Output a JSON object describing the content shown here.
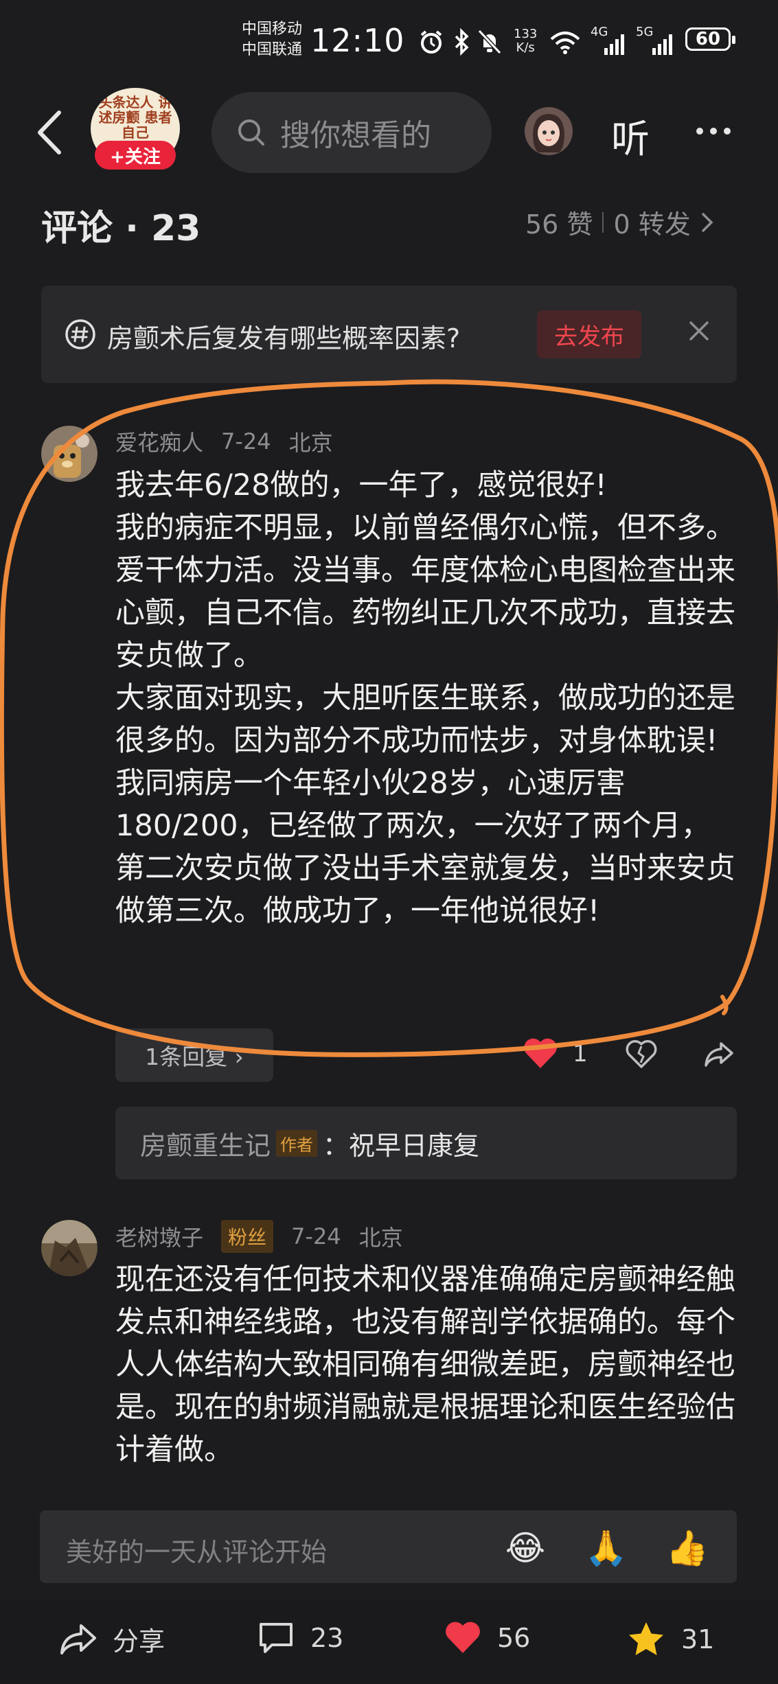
{
  "status_bar": {
    "carrier1": "中国移动",
    "carrier2": "中国联通",
    "time": "12:10",
    "net_speed_value": "133",
    "net_speed_unit": "K/s",
    "signal1_label": "4G",
    "signal2_label": "5G",
    "battery": "60"
  },
  "header": {
    "logo_text": "头条达人 讲述房颤 患者自己",
    "follow_label": "+关注",
    "search_placeholder": "搜你想看的",
    "listen_label": "听"
  },
  "comments_header": {
    "title": "评论 · 23",
    "likes": "56 赞",
    "shares": "0 转发"
  },
  "prompt": {
    "question": "房颤术后复发有哪些概率因素?",
    "publish_label": "去发布"
  },
  "comments": [
    {
      "author": "爱花痴人",
      "date": "7-24",
      "location": "北京",
      "paragraphs": [
        "我去年6/28做的，一年了，感觉很好!",
        "我的病症不明显，以前曾经偶尔心慌，但不多。爱干体力活。没当事。年度体检心电图检查出来心颤，自己不信。药物纠正几次不成功，直接去安贞做了。",
        "大家面对现实，大胆听医生联系，做成功的还是很多的。因为部分不成功而怯步，对身体耽误!",
        "我同病房一个年轻小伙28岁，心速厉害180/200，已经做了两次，一次好了两个月，第二次安贞做了没出手术室就复发，当时来安贞做第三次。做成功了，一年他说很好!"
      ],
      "replies_label": "1条回复 ›",
      "like_count": "1",
      "author_reply": {
        "name": "房颤重生记",
        "badge": "作者",
        "text": "：祝早日康复"
      }
    },
    {
      "author": "老树墩子",
      "badge": "粉丝",
      "date": "7-24",
      "location": "北京",
      "paragraphs": [
        "现在还没有任何技术和仪器准确确定房颤神经触发点和神经线路，也没有解剖学依据确的。每个人人体结构大致相同确有细微差距，房颤神经也是。现在的射频消融就是根据理论和医生经验估计着做。"
      ]
    }
  ],
  "input_bar": {
    "placeholder": "美好的一天从评论开始",
    "emojis": [
      "😂",
      "🙏",
      "👍"
    ]
  },
  "bottom_bar": {
    "share_label": "分享",
    "comments_count": "23",
    "likes_count": "56",
    "favorites_count": "31"
  },
  "colors": {
    "background": "#1c1c1e",
    "accent_red": "#e8233a",
    "annotation_orange": "#ee8a3c",
    "favorite_yellow": "#f7c21e"
  }
}
